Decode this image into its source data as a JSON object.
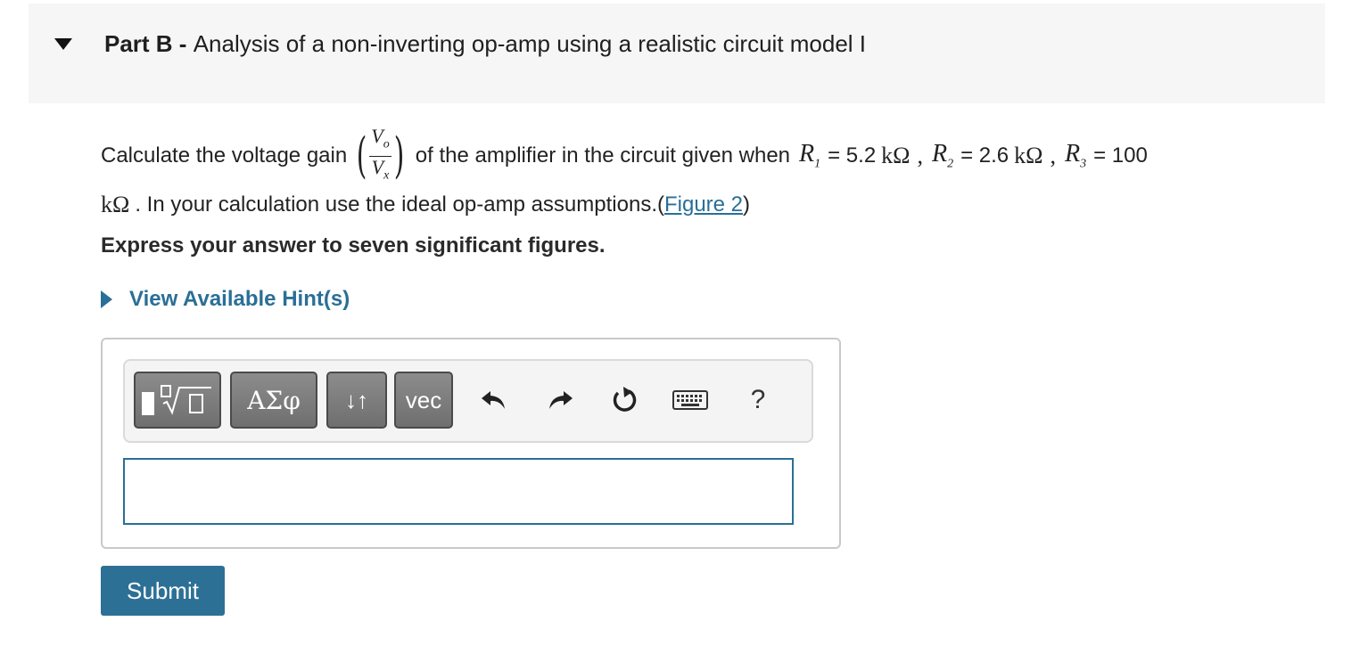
{
  "header": {
    "part_label": "Part B",
    "separator": " - ",
    "title": "Analysis of a non-inverting op-amp using a realistic circuit model I"
  },
  "question": {
    "prefix": "Calculate the voltage gain",
    "frac_num": "V",
    "frac_num_sub": "o",
    "frac_den": "V",
    "frac_den_sub": "x",
    "middle": "of the amplifier in the circuit given when",
    "r1_sym": "R",
    "r1_sub": "1",
    "r1_eq": "= 5.2",
    "r2_sym": "R",
    "r2_sub": "2",
    "r2_eq": "= 2.6",
    "r3_sym": "R",
    "r3_sub": "3",
    "r3_eq": "= 100",
    "unit": "kΩ",
    "sep": ",",
    "line2_text": ". In your calculation use the ideal op-amp assumptions.(",
    "figure_link": "Figure 2",
    "line2_close": ")"
  },
  "instruction": "Express your answer to seven significant figures.",
  "hint": {
    "label": "View Available Hint(s)"
  },
  "toolbar": {
    "greek_label": "ΑΣφ",
    "arrows_label": "↓↑",
    "vec_label": "vec",
    "help_label": "?"
  },
  "answer": {
    "value": "",
    "placeholder": ""
  },
  "submit_label": "Submit"
}
